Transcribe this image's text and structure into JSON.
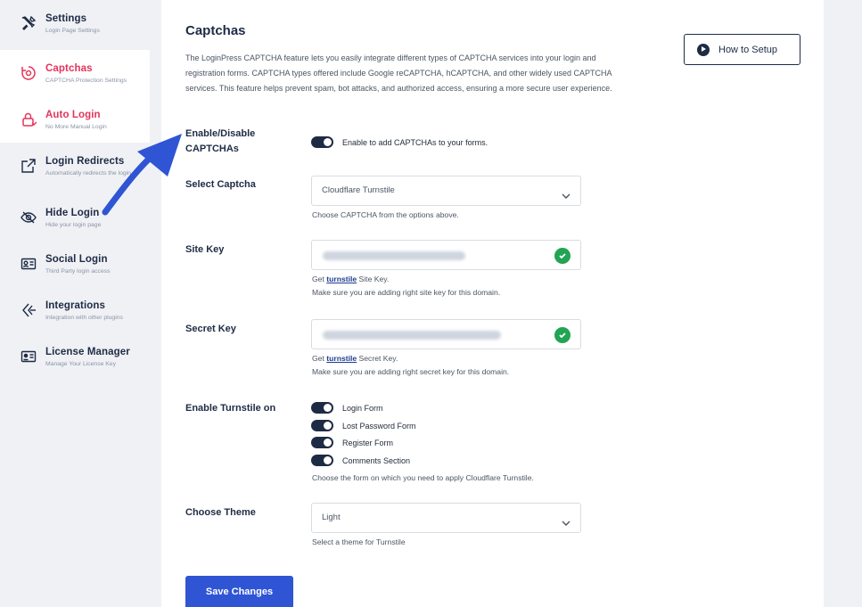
{
  "sidebar": {
    "items": [
      {
        "title": "Settings",
        "sub": "Login Page Settings",
        "icon": "tools-icon"
      },
      {
        "title": "Captchas",
        "sub": "CAPTCHA Protection Settings",
        "icon": "captcha-icon"
      },
      {
        "title": "Auto Login",
        "sub": "No More Manual Login",
        "icon": "lock-icon"
      },
      {
        "title": "Login Redirects",
        "sub": "Automatically redirects the login",
        "icon": "external-link-icon"
      },
      {
        "title": "Hide Login",
        "sub": "Hide your login page",
        "icon": "eye-slash-icon"
      },
      {
        "title": "Social Login",
        "sub": "Third Party login access",
        "icon": "id-card-icon"
      },
      {
        "title": "Integrations",
        "sub": "Integration with other plugins",
        "icon": "integrations-icon"
      },
      {
        "title": "License Manager",
        "sub": "Manage Your License Key",
        "icon": "license-icon"
      }
    ]
  },
  "main": {
    "title": "Captchas",
    "description": "The LoginPress CAPTCHA feature lets you easily integrate different types of CAPTCHA services into your login and registration forms. CAPTCHA types offered include Google reCAPTCHA, hCAPTCHA, and other widely used CAPTCHA services. This feature helps prevent spam, bot attacks, and authorized access, ensuring a more secure user experience.",
    "how_to_setup": "How to Setup",
    "enable": {
      "label": "Enable/Disable CAPTCHAs",
      "toggle_text": "Enable to add CAPTCHAs to your forms."
    },
    "select_captcha": {
      "label": "Select Captcha",
      "value": "Cloudflare Turnstile",
      "help": "Choose CAPTCHA from the options above."
    },
    "site_key": {
      "label": "Site Key",
      "help_prefix": "Get ",
      "help_link": "turnstile",
      "help_suffix": " Site Key.",
      "help2": "Make sure you are adding right site key for this domain."
    },
    "secret_key": {
      "label": "Secret Key",
      "help_prefix": "Get ",
      "help_link": "turnstile",
      "help_suffix": " Secret Key.",
      "help2": "Make sure you are adding right secret key for this domain."
    },
    "turnstile_on": {
      "label": "Enable Turnstile on",
      "options": [
        "Login Form",
        "Lost Password Form",
        "Register Form",
        "Comments Section"
      ],
      "help": "Choose the form on which you need to apply Cloudflare Turnstile."
    },
    "theme": {
      "label": "Choose Theme",
      "value": "Light",
      "help": "Select a theme for Turnstile"
    },
    "save": "Save Changes"
  },
  "colors": {
    "accent": "#2f55d4",
    "dark": "#1e2b45",
    "red": "#e5345a",
    "success": "#22a454"
  }
}
